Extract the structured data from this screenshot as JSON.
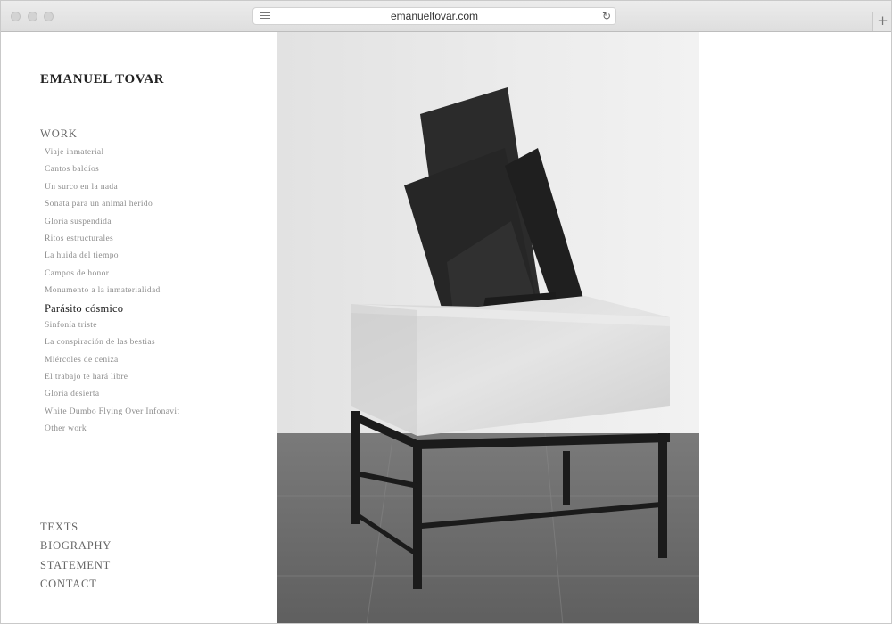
{
  "browser": {
    "url": "emanueltovar.com",
    "reader_icon": "reader-icon",
    "reload_icon": "reload-icon",
    "new_tab_icon": "plus-icon",
    "new_tab_symbol": "+",
    "reload_symbol": "↻"
  },
  "site": {
    "title": "EMANUEL TOVAR"
  },
  "work": {
    "heading": "WORK",
    "items": [
      "Viaje inmaterial",
      "Cantos baldíos",
      "Un surco en la nada",
      "Sonata para un animal herido",
      "Gloria suspendida",
      "Ritos estructurales",
      "La huida del tiempo",
      "Campos de honor",
      "Monumento a la inmaterialidad",
      "Parásito cósmico",
      "Sinfonía triste",
      "La conspiración de las bestias",
      "Miércoles de ceniza",
      "El trabajo te hará libre",
      "Gloria desierta",
      "White Dumbo Flying Over Infonavit",
      "Other work"
    ],
    "active_item": "Parásito cósmico"
  },
  "nav": {
    "texts": "TEXTS",
    "biography": "BIOGRAPHY",
    "statement": "STATEMENT",
    "contact": "CONTACT"
  },
  "colors": {
    "title": "#222222",
    "menu": "#666666",
    "menu_item": "#8c8c8c",
    "wall": "#e9e9e9",
    "floor": "#6a6a6a",
    "sculpture": "#2a2a2a",
    "plinth": "#dcdcdc"
  }
}
